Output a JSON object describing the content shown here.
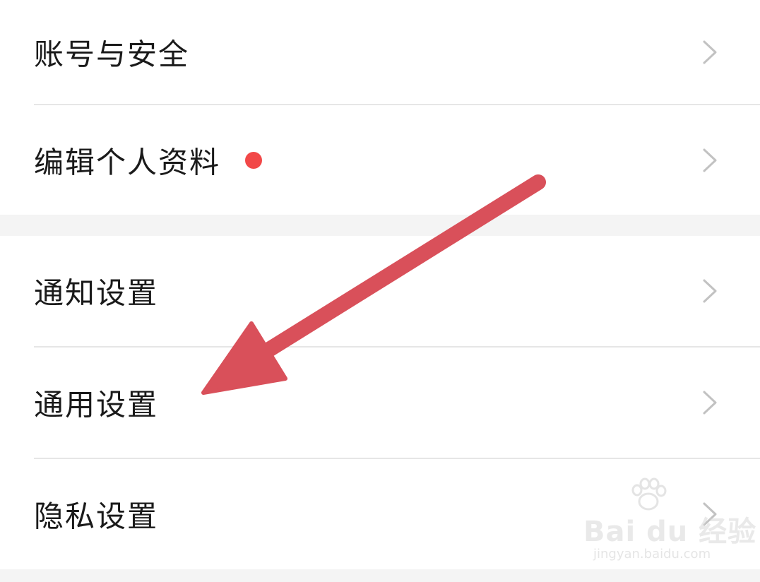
{
  "settings": {
    "group1": [
      {
        "label": "账号与安全",
        "has_dot": false
      },
      {
        "label": "编辑个人资料",
        "has_dot": true
      }
    ],
    "group2": [
      {
        "label": "通知设置"
      },
      {
        "label": "通用设置"
      },
      {
        "label": "隐私设置"
      }
    ]
  },
  "colors": {
    "text": "#1a1a1a",
    "chevron": "#c2c2c2",
    "divider": "#e6e6e6",
    "section_gap": "#f4f4f4",
    "badge_dot": "#f24848",
    "annotation_arrow": "#d9505a"
  },
  "icons": {
    "row_chevron": "chevron-right-icon",
    "badge": "red-dot-badge",
    "annotation": "arrow-annotation",
    "watermark_logo": "paw-icon"
  },
  "watermark": {
    "brand_text": "Bai du 经验",
    "site_text": "jingyan.baidu.com"
  }
}
